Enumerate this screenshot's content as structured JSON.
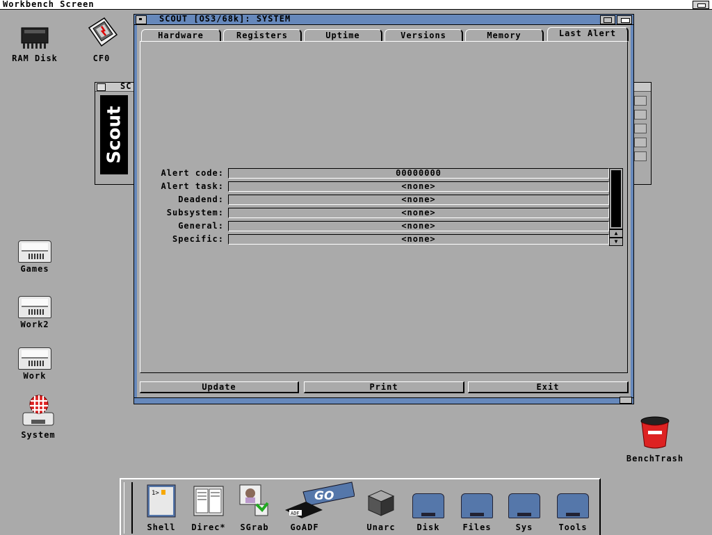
{
  "screen": {
    "title": "Workbench Screen"
  },
  "desktop": {
    "icons": [
      {
        "label": "RAM Disk"
      },
      {
        "label": "CF0"
      },
      {
        "label": "Games"
      },
      {
        "label": "Work2"
      },
      {
        "label": "Work"
      },
      {
        "label": "System"
      },
      {
        "label": "BenchTrash"
      }
    ]
  },
  "background_window": {
    "title": "SC",
    "logo": "Scout"
  },
  "window": {
    "title": "SCOUT [OS3/68k]: SYSTEM",
    "tabs": [
      "Hardware",
      "Registers",
      "Uptime",
      "Versions",
      "Memory",
      "Last Alert"
    ],
    "active_tab": "Last Alert",
    "fields": [
      {
        "label": "Alert code:",
        "value": "00000000"
      },
      {
        "label": "Alert task:",
        "value": "<none>"
      },
      {
        "label": "Deadend:",
        "value": "<none>"
      },
      {
        "label": "Subsystem:",
        "value": "<none>"
      },
      {
        "label": "General:",
        "value": "<none>"
      },
      {
        "label": "Specific:",
        "value": "<none>"
      }
    ],
    "buttons": [
      {
        "label": "Update"
      },
      {
        "label": "Print"
      },
      {
        "label": "Exit"
      }
    ]
  },
  "dock": {
    "items": [
      {
        "label": "Shell"
      },
      {
        "label": "Direc*"
      },
      {
        "label": "SGrab"
      },
      {
        "label": "GoADF"
      },
      {
        "label": "Unarc"
      },
      {
        "label": "Disk"
      },
      {
        "label": "Files"
      },
      {
        "label": "Sys"
      },
      {
        "label": "Tools"
      }
    ],
    "goadf_badge": "ADF",
    "goadf_logo": "GO"
  },
  "colors": {
    "desktop": "#aaaaaa",
    "window_border": "#6688bb",
    "drawer": "#5577aa",
    "trash": "#dd2222"
  }
}
